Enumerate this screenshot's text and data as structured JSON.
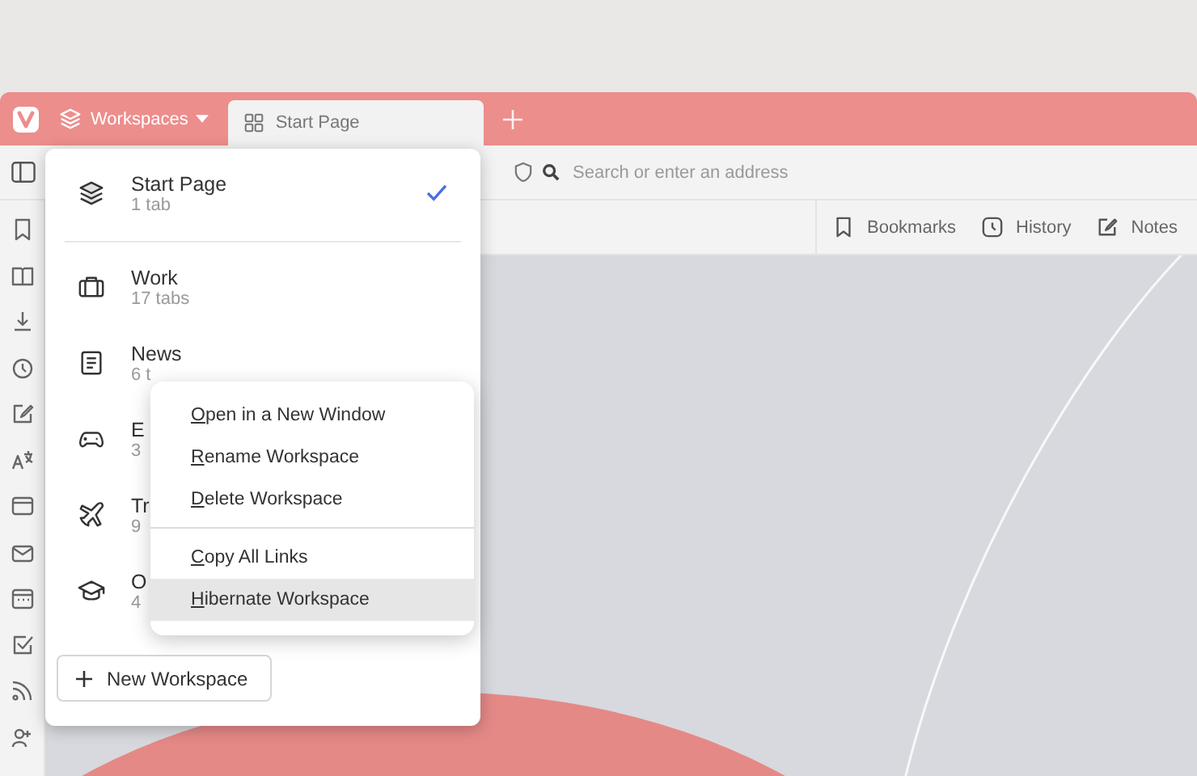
{
  "tab_bar": {
    "workspaces_button": "Workspaces",
    "tabs": [
      {
        "label": "Start Page",
        "selected": true
      }
    ]
  },
  "address_bar": {
    "placeholder": "Search or enter an address"
  },
  "bookmark_bar": {
    "items": [
      "Bookmarks",
      "History",
      "Notes"
    ]
  },
  "workspace_menu": {
    "items": [
      {
        "name": "Start Page",
        "count": "1 tab",
        "selected": true
      },
      {
        "name": "Work",
        "count": "17 tabs",
        "selected": false
      },
      {
        "name": "News",
        "count": "6 t",
        "selected": false
      },
      {
        "name": "E",
        "count": "3",
        "selected": false
      },
      {
        "name": "Tr",
        "count": "9",
        "selected": false
      },
      {
        "name": "O",
        "count": "4",
        "selected": false
      }
    ],
    "new_button": "New Workspace"
  },
  "context_menu": {
    "groups": [
      [
        {
          "label": "Open in a New Window",
          "highlighted": false
        },
        {
          "label": "Rename Workspace",
          "highlighted": false
        },
        {
          "label": "Delete Workspace",
          "highlighted": false
        }
      ],
      [
        {
          "label": "Copy All Links",
          "highlighted": false
        },
        {
          "label": "Hibernate Workspace",
          "highlighted": true
        }
      ]
    ]
  }
}
